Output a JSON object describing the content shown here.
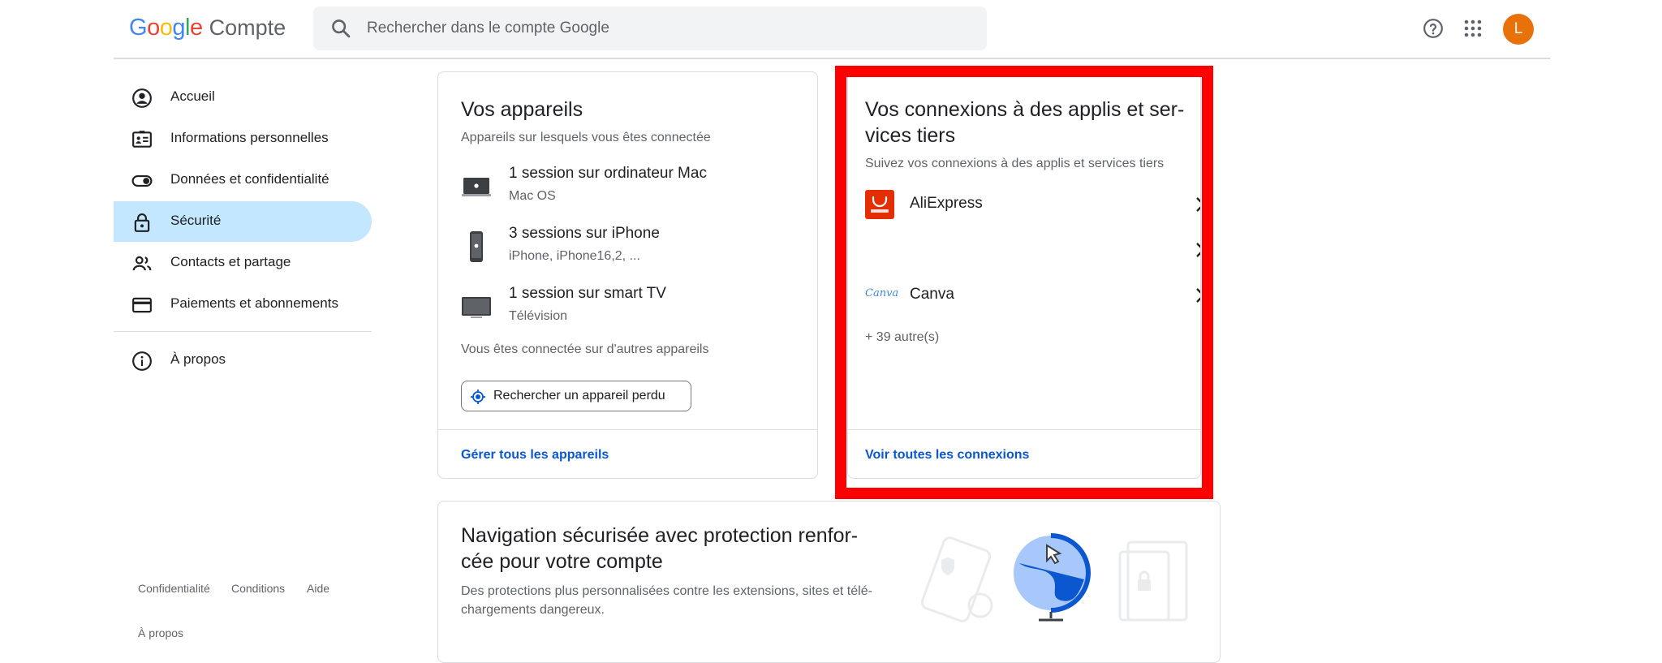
{
  "header": {
    "logo_letters": [
      "G",
      "o",
      "o",
      "g",
      "l",
      "e"
    ],
    "product": "Compte",
    "search_placeholder": "Rechercher dans le compte Google",
    "avatar_letter": "L",
    "avatar_color": "#e8710a"
  },
  "sidebar": {
    "items": [
      {
        "label": "Accueil",
        "icon": "account-circle-icon"
      },
      {
        "label": "Informations personnelles",
        "icon": "id-card-icon"
      },
      {
        "label": "Données et confidentialité",
        "icon": "toggle-icon"
      },
      {
        "label": "Sécurité",
        "icon": "lock-icon",
        "active": true
      },
      {
        "label": "Contacts et partage",
        "icon": "people-icon"
      },
      {
        "label": "Paiements et abonnements",
        "icon": "credit-card-icon"
      },
      {
        "label": "À propos",
        "icon": "info-icon"
      }
    ],
    "footer": {
      "privacy": "Confidentialité",
      "terms": "Conditions",
      "help": "Aide",
      "about": "À propos"
    }
  },
  "devices_card": {
    "title": "Vos appareils",
    "subtitle": "Appareils sur lesquels vous êtes connectée",
    "devices": [
      {
        "name": "1 session sur ordinateur Mac",
        "detail": "Mac OS",
        "icon": "laptop-icon"
      },
      {
        "name": "3 sessions sur iPhone",
        "detail": "iPhone, iPhone16,2, ...",
        "icon": "phone-icon"
      },
      {
        "name": "1 session sur smart TV",
        "detail": "Télévision",
        "icon": "tv-icon"
      }
    ],
    "other_devices": "Vous êtes connectée sur d'autres appareils",
    "find_device_label": "Rechercher un appareil perdu",
    "manage_link": "Gérer tous les appareils"
  },
  "connections_card": {
    "title_line1": "Vos connexions à des applis et ser-",
    "title_line2": "vices tiers",
    "subtitle": "Suivez vos connexions à des applis et services tiers",
    "apps": [
      {
        "name": "AliExpress",
        "logo_text": "AliExpress",
        "color": "#e62e04"
      },
      {
        "name": "",
        "logo_text": "",
        "color": ""
      },
      {
        "name": "Canva",
        "logo_text": "Canva",
        "color": "#7d2ae8"
      }
    ],
    "more": "+ 39 autre(s)",
    "see_all_link": "Voir toutes les connexions"
  },
  "nav_card": {
    "title_line1": "Navigation sécurisée avec protection renfor-",
    "title_line2": "cée pour votre compte",
    "desc_line1": "Des protections plus personnalisées contre les extensions, sites et télé-",
    "desc_line2": "chargements dangereux."
  },
  "highlight_color": "#ff0000"
}
